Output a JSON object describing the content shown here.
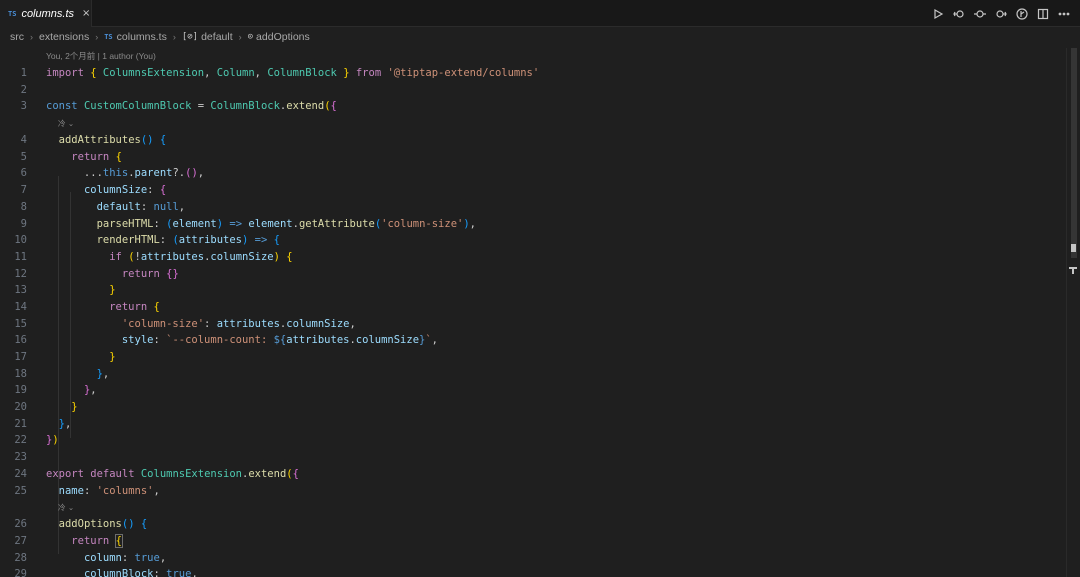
{
  "tab": {
    "badge": "TS",
    "title": "columns.ts",
    "close": "×"
  },
  "actions": [
    {
      "name": "run-icon"
    },
    {
      "name": "go-back-icon"
    },
    {
      "name": "commit-icon"
    },
    {
      "name": "go-forward-icon"
    },
    {
      "name": "branch-icon"
    },
    {
      "name": "split-editor-icon"
    },
    {
      "name": "more-actions-icon"
    }
  ],
  "breadcrumb": {
    "src": "src",
    "extensions": "extensions",
    "file_badge": "TS",
    "file": "columns.ts",
    "default_icon": "[⊘]",
    "default": "default",
    "method_icon": "⊙",
    "method": "addOptions"
  },
  "lens": {
    "blame": "You, 2个月前 | 1 author (You)",
    "inlay": "冷 ⌄"
  },
  "colors": {
    "background": "#1f1f1f",
    "keyword": "#569cd6",
    "string": "#ce9178",
    "class": "#4ec9b0"
  },
  "code_lines": [
    {
      "n": "1",
      "t": "import { ColumnsExtension, Column, ColumnBlock } from '@tiptap-extend/columns'"
    },
    {
      "n": "2",
      "t": ""
    },
    {
      "n": "3",
      "t": "const CustomColumnBlock = ColumnBlock.extend({"
    },
    {
      "n": "4",
      "t": "  addAttributes() {"
    },
    {
      "n": "5",
      "t": "    return {"
    },
    {
      "n": "6",
      "t": "      ...this.parent?.(),"
    },
    {
      "n": "7",
      "t": "      columnSize: {"
    },
    {
      "n": "8",
      "t": "        default: null,"
    },
    {
      "n": "9",
      "t": "        parseHTML: (element) => element.getAttribute('column-size'),"
    },
    {
      "n": "10",
      "t": "        renderHTML: (attributes) => {"
    },
    {
      "n": "11",
      "t": "          if (!attributes.columnSize) {"
    },
    {
      "n": "12",
      "t": "            return {}"
    },
    {
      "n": "13",
      "t": "          }"
    },
    {
      "n": "14",
      "t": "          return {"
    },
    {
      "n": "15",
      "t": "            'column-size': attributes.columnSize,"
    },
    {
      "n": "16",
      "t": "            style: `--column-count: ${attributes.columnSize}`,"
    },
    {
      "n": "17",
      "t": "          }"
    },
    {
      "n": "18",
      "t": "        },"
    },
    {
      "n": "19",
      "t": "      },"
    },
    {
      "n": "20",
      "t": "    }"
    },
    {
      "n": "21",
      "t": "  },"
    },
    {
      "n": "22",
      "t": "})"
    },
    {
      "n": "23",
      "t": ""
    },
    {
      "n": "24",
      "t": "export default ColumnsExtension.extend({"
    },
    {
      "n": "25",
      "t": "  name: 'columns',"
    },
    {
      "n": "26",
      "t": "  addOptions() {"
    },
    {
      "n": "27",
      "t": "    return {"
    },
    {
      "n": "28",
      "t": "      column: true,"
    },
    {
      "n": "29",
      "t": "      columnBlock: true,"
    }
  ]
}
